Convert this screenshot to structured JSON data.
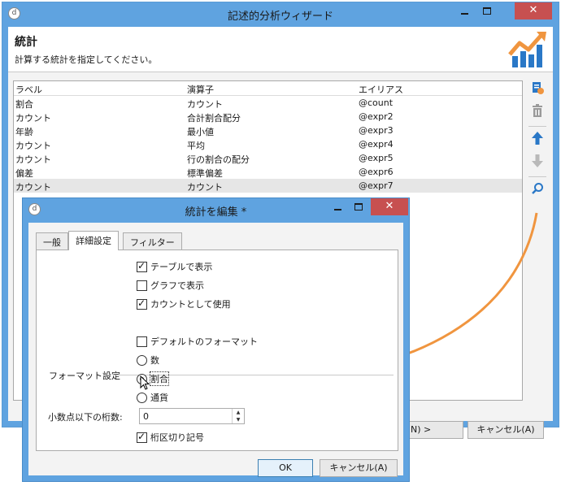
{
  "main": {
    "title": "記述的分析ウィザード",
    "header_title": "統計",
    "header_subtitle": "計算する統計を指定してください。",
    "columns": [
      "ラベル",
      "演算子",
      "エイリアス"
    ],
    "rows": [
      [
        "割合",
        "カウント",
        "@count"
      ],
      [
        "カウント",
        "合計割合配分",
        "@expr2"
      ],
      [
        "年齢",
        "最小値",
        "@expr3"
      ],
      [
        "カウント",
        "平均",
        "@expr4"
      ],
      [
        "カウント",
        "行の割合の配分",
        "@expr5"
      ],
      [
        "偏差",
        "標準偏差",
        "@expr6"
      ],
      [
        "カウント",
        "カウント",
        "@expr7"
      ]
    ],
    "next_button_fragment": "N) >",
    "cancel_button": "キャンセル(A)",
    "close_glyph": "✕",
    "min_label": "",
    "icons": [
      "add-icon",
      "delete-icon",
      "move-up-icon",
      "move-down-icon",
      "search-icon"
    ]
  },
  "dialog": {
    "title": "統計を編集 *",
    "tabs": [
      "一般",
      "詳細設定",
      "フィルター"
    ],
    "show_table": "テーブルで表示",
    "show_graph": "グラフで表示",
    "use_as_count": "カウントとして使用",
    "format_section": "フォーマット設定",
    "default_format": "デフォルトのフォーマット",
    "radio_number": "数",
    "radio_percent": "割合",
    "radio_currency": "通貨",
    "decimals_label": "小数点以下の桁数:",
    "decimals_value": "0",
    "thousands_sep": "桁区切り記号",
    "ok": "OK",
    "cancel": "キャンセル(A)",
    "close_glyph": "✕"
  },
  "colors": {
    "accent": "#5fa3e0",
    "close": "#c75050",
    "arrow": "#f0953f",
    "icon_blue": "#2a78c7"
  }
}
